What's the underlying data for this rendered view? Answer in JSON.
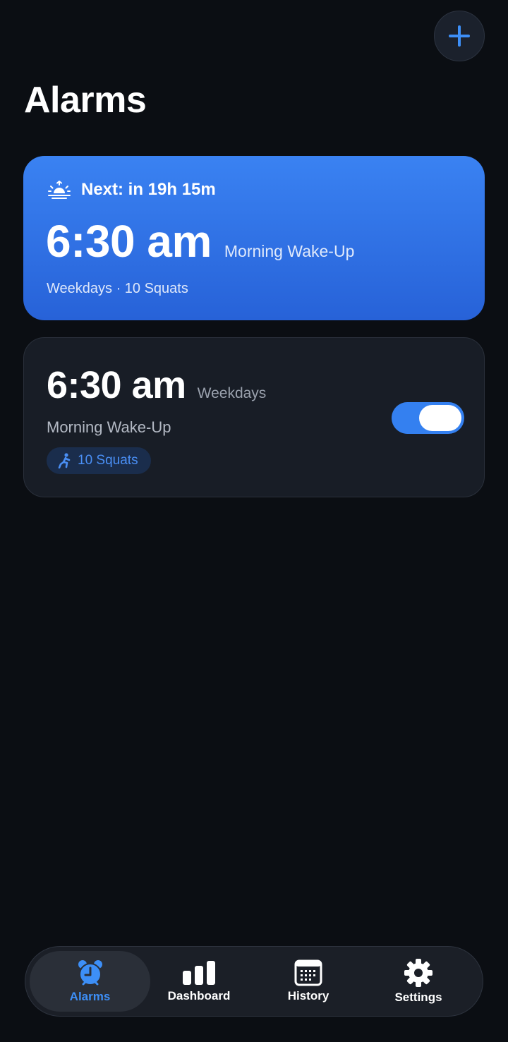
{
  "header": {
    "title": "Alarms",
    "add_icon": "plus-icon"
  },
  "next_alarm": {
    "label": "Next: in 19h 15m",
    "icon": "sunrise-icon",
    "time": "6:30 am",
    "name": "Morning Wake-Up",
    "subtitle": "Weekdays · 10 Squats"
  },
  "alarms": [
    {
      "time": "6:30 am",
      "repeat": "Weekdays",
      "name": "Morning Wake-Up",
      "challenge": "10 Squats",
      "challenge_icon": "squat-figure-icon",
      "enabled": true
    }
  ],
  "tabbar": {
    "tabs": [
      {
        "label": "Alarms",
        "icon": "alarm-clock-icon",
        "active": true
      },
      {
        "label": "Dashboard",
        "icon": "bar-chart-icon",
        "active": false
      },
      {
        "label": "History",
        "icon": "calendar-icon",
        "active": false
      },
      {
        "label": "Settings",
        "icon": "gear-icon",
        "active": false
      }
    ]
  },
  "colors": {
    "background": "#0b0e13",
    "accent": "#3480f0",
    "card": "#181d26",
    "hero_top": "#3a82f2",
    "hero_bottom": "#2762d8"
  }
}
